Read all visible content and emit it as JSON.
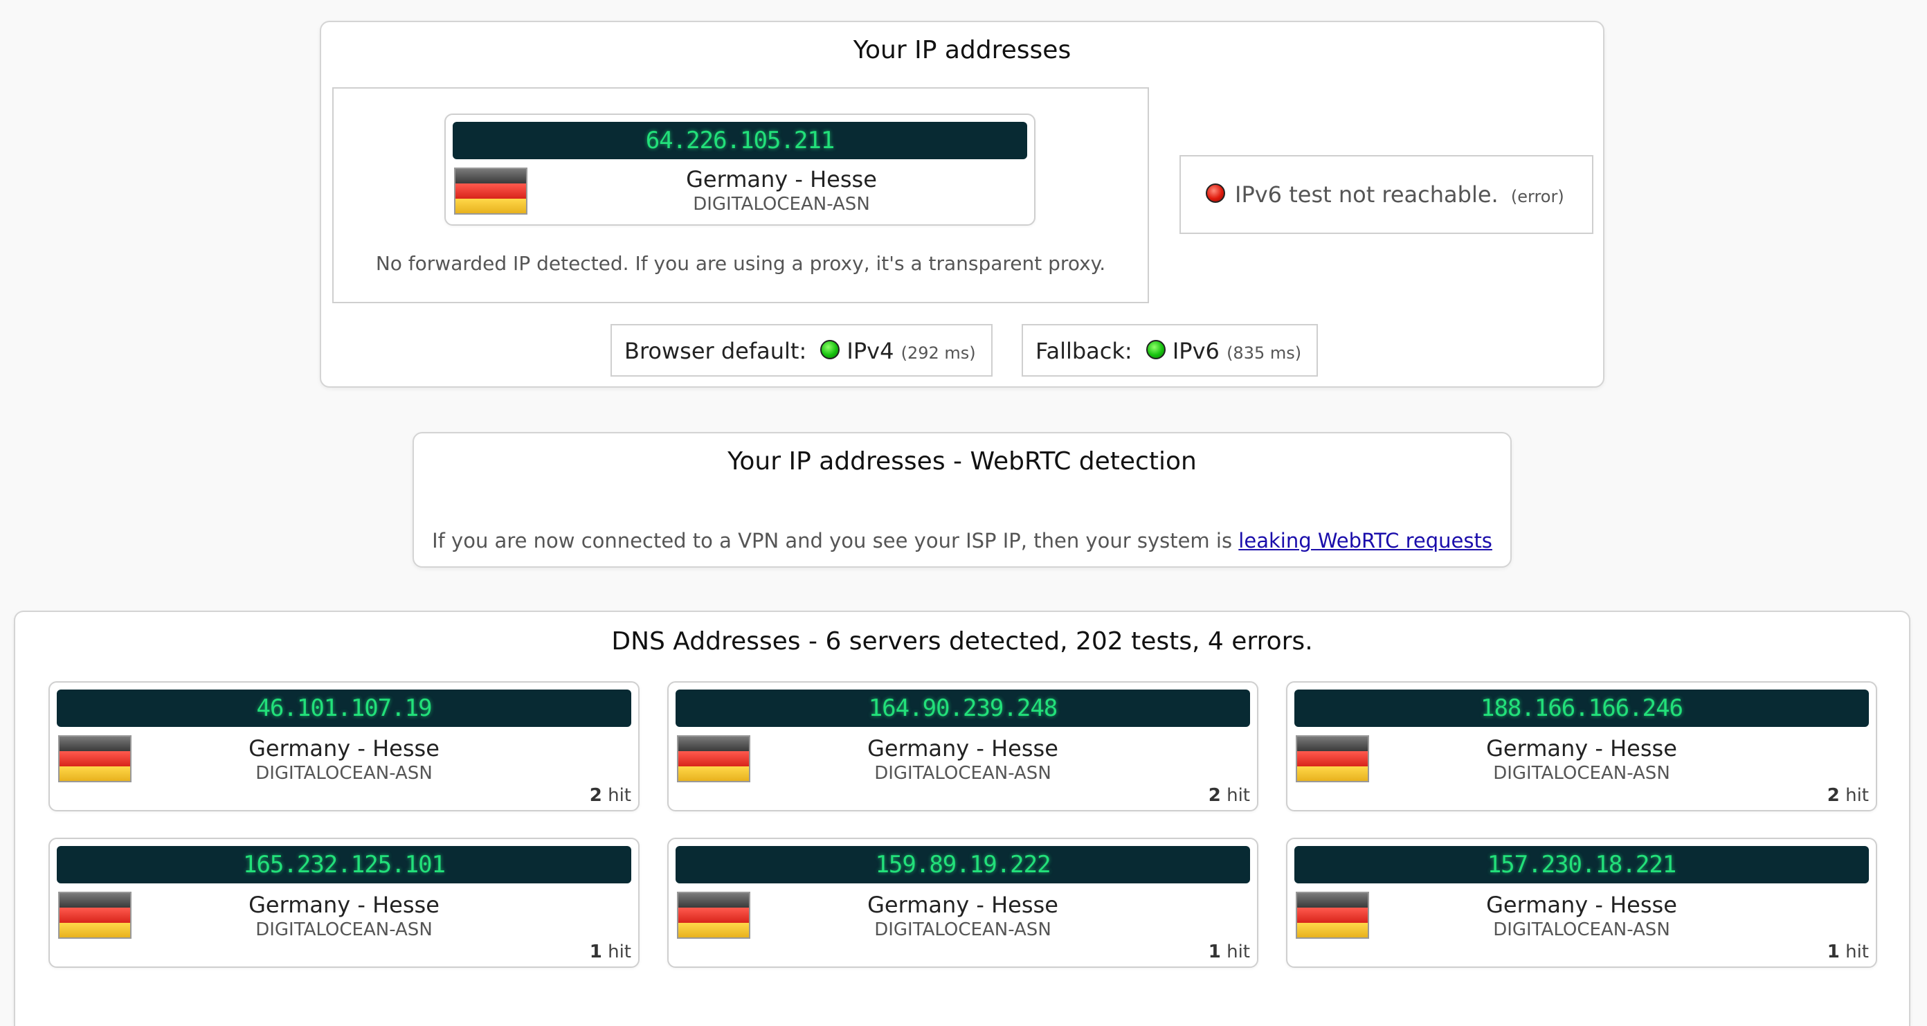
{
  "ip_panel": {
    "title": "Your IP addresses",
    "ipv4": {
      "ip": "64.226.105.211",
      "location": "Germany - Hesse",
      "asn": "DIGITALOCEAN-ASN",
      "flag": "germany-flag"
    },
    "forward_note": "No forwarded IP detected. If you are using a proxy, it's a transparent proxy.",
    "ipv6": {
      "status_icon": "red-status-dot",
      "message": "IPv6 test not reachable.",
      "detail": "(error)"
    },
    "browser_default": {
      "label": "Browser default:",
      "protocol": "IPv4",
      "time": "(292 ms)"
    },
    "fallback": {
      "label": "Fallback:",
      "protocol": "IPv6",
      "time": "(835 ms)"
    }
  },
  "webrtc_panel": {
    "title": "Your IP addresses - WebRTC detection",
    "note": "If you are now connected to a VPN and you see your ISP IP, then your system is ",
    "link_text": "leaking WebRTC requests"
  },
  "dns_panel": {
    "title": "DNS Addresses - 6 servers detected, 202 tests, 4 errors.",
    "servers": [
      {
        "ip": "46.101.107.19",
        "location": "Germany - Hesse",
        "asn": "DIGITALOCEAN-ASN",
        "hits": "2",
        "hit_label": "hit"
      },
      {
        "ip": "164.90.239.248",
        "location": "Germany - Hesse",
        "asn": "DIGITALOCEAN-ASN",
        "hits": "2",
        "hit_label": "hit"
      },
      {
        "ip": "188.166.166.246",
        "location": "Germany - Hesse",
        "asn": "DIGITALOCEAN-ASN",
        "hits": "2",
        "hit_label": "hit"
      },
      {
        "ip": "165.232.125.101",
        "location": "Germany - Hesse",
        "asn": "DIGITALOCEAN-ASN",
        "hits": "1",
        "hit_label": "hit"
      },
      {
        "ip": "159.89.19.222",
        "location": "Germany - Hesse",
        "asn": "DIGITALOCEAN-ASN",
        "hits": "1",
        "hit_label": "hit"
      },
      {
        "ip": "157.230.18.221",
        "location": "Germany - Hesse",
        "asn": "DIGITALOCEAN-ASN",
        "hits": "1",
        "hit_label": "hit"
      }
    ]
  },
  "colors": {
    "ip_bar_bg": "#082a33",
    "ip_text": "#22e07a",
    "ok": "#17c20f",
    "error": "#e01b0d",
    "link": "#1a0dab"
  }
}
